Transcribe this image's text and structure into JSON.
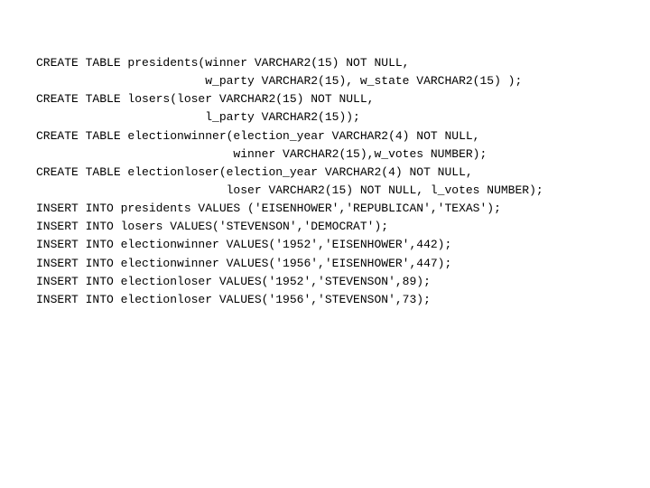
{
  "lines": [
    "CREATE TABLE presidents(winner VARCHAR2(15) NOT NULL,",
    "                        w_party VARCHAR2(15), w_state VARCHAR2(15) );",
    "CREATE TABLE losers(loser VARCHAR2(15) NOT NULL,",
    "                        l_party VARCHAR2(15));",
    "CREATE TABLE electionwinner(election_year VARCHAR2(4) NOT NULL,",
    "                            winner VARCHAR2(15),w_votes NUMBER);",
    "CREATE TABLE electionloser(election_year VARCHAR2(4) NOT NULL,",
    "                           loser VARCHAR2(15) NOT NULL, l_votes NUMBER);",
    "",
    "",
    "INSERT INTO presidents VALUES ('EISENHOWER','REPUBLICAN','TEXAS');",
    "INSERT INTO losers VALUES('STEVENSON','DEMOCRAT');",
    "INSERT INTO electionwinner VALUES('1952','EISENHOWER',442);",
    "INSERT INTO electionwinner VALUES('1956','EISENHOWER',447);",
    "INSERT INTO electionloser VALUES('1952','STEVENSON',89);",
    "INSERT INTO electionloser VALUES('1956','STEVENSON',73);"
  ]
}
